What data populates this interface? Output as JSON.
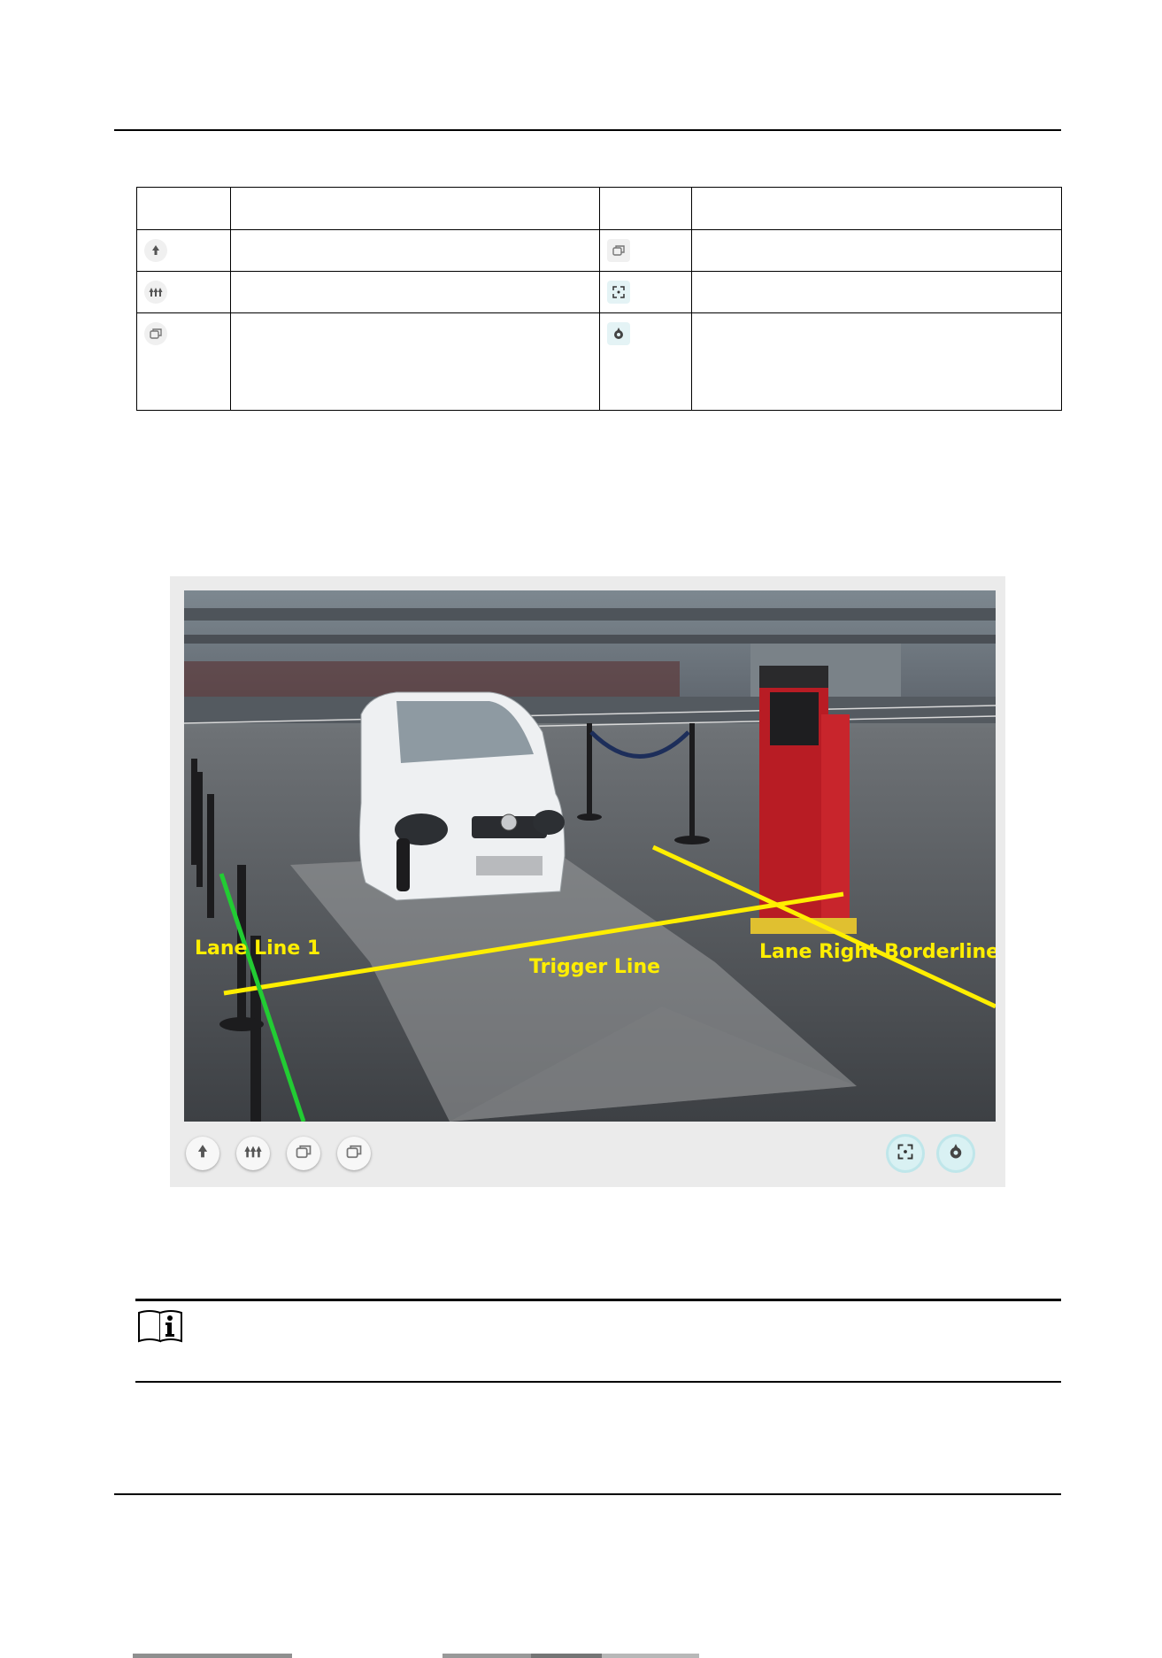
{
  "table": {
    "header": [
      "",
      "",
      "",
      ""
    ],
    "rows": [
      {
        "left_icon": "pin-tree-icon",
        "left_text": "",
        "right_icon": "overlap-square-icon",
        "right_text": ""
      },
      {
        "left_icon": "multi-tree-icon",
        "left_text": "",
        "right_icon": "focus-frame-icon",
        "right_text": ""
      },
      {
        "left_icon": "overlap-square-icon",
        "left_text": "",
        "right_icon": "drop-icon",
        "right_text": ""
      }
    ]
  },
  "figure": {
    "labels": {
      "lane_line": "Lane Line 1",
      "trigger_line": "Trigger Line",
      "lane_right": "Lane Right Borderline"
    },
    "colors": {
      "trigger_line": "#ffee00",
      "lane_line": "#22cc33",
      "label_text": "#ffee00",
      "active_button": "#d9f1f3"
    },
    "toolbar": {
      "left_buttons": [
        "pin-tree-icon",
        "multi-tree-icon",
        "overlap-square-icon",
        "overlap-square-icon"
      ],
      "right_buttons": [
        "focus-frame-icon",
        "drop-icon"
      ]
    }
  },
  "note": {
    "icon": "info-book-icon",
    "text": ""
  }
}
